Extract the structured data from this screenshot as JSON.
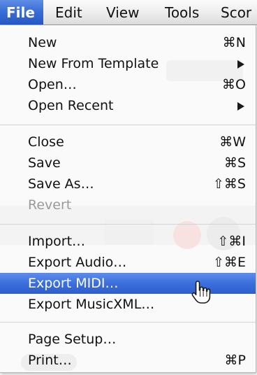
{
  "menubar": {
    "items": [
      {
        "label": "File",
        "active": true
      },
      {
        "label": "Edit"
      },
      {
        "label": "View"
      },
      {
        "label": "Tools"
      },
      {
        "label": "Scor"
      }
    ]
  },
  "file_menu": {
    "groups": [
      [
        {
          "label": "New",
          "shortcut": "⌘N"
        },
        {
          "label": "New From Template",
          "submenu": true
        },
        {
          "label": "Open…",
          "shortcut": "⌘O"
        },
        {
          "label": "Open Recent",
          "submenu": true
        }
      ],
      [
        {
          "label": "Close",
          "shortcut": "⌘W"
        },
        {
          "label": "Save",
          "shortcut": "⌘S"
        },
        {
          "label": "Save As…",
          "shortcut": "⇧⌘S"
        },
        {
          "label": "Revert",
          "disabled": true
        }
      ],
      [
        {
          "label": "Import…",
          "shortcut": "⇧⌘I"
        },
        {
          "label": "Export Audio…",
          "shortcut": "⇧⌘E"
        },
        {
          "label": "Export MIDI…",
          "highlighted": true
        },
        {
          "label": "Export MusicXML…"
        }
      ],
      [
        {
          "label": "Page Setup…"
        },
        {
          "label": "Print…",
          "shortcut": "⌘P"
        }
      ]
    ]
  },
  "cursor": {
    "icon": "pointing-hand-cursor-icon"
  },
  "colors": {
    "highlight": "#3c6fdc",
    "disabled_text": "#9a9a9a",
    "separator": "#d4d4d4"
  }
}
